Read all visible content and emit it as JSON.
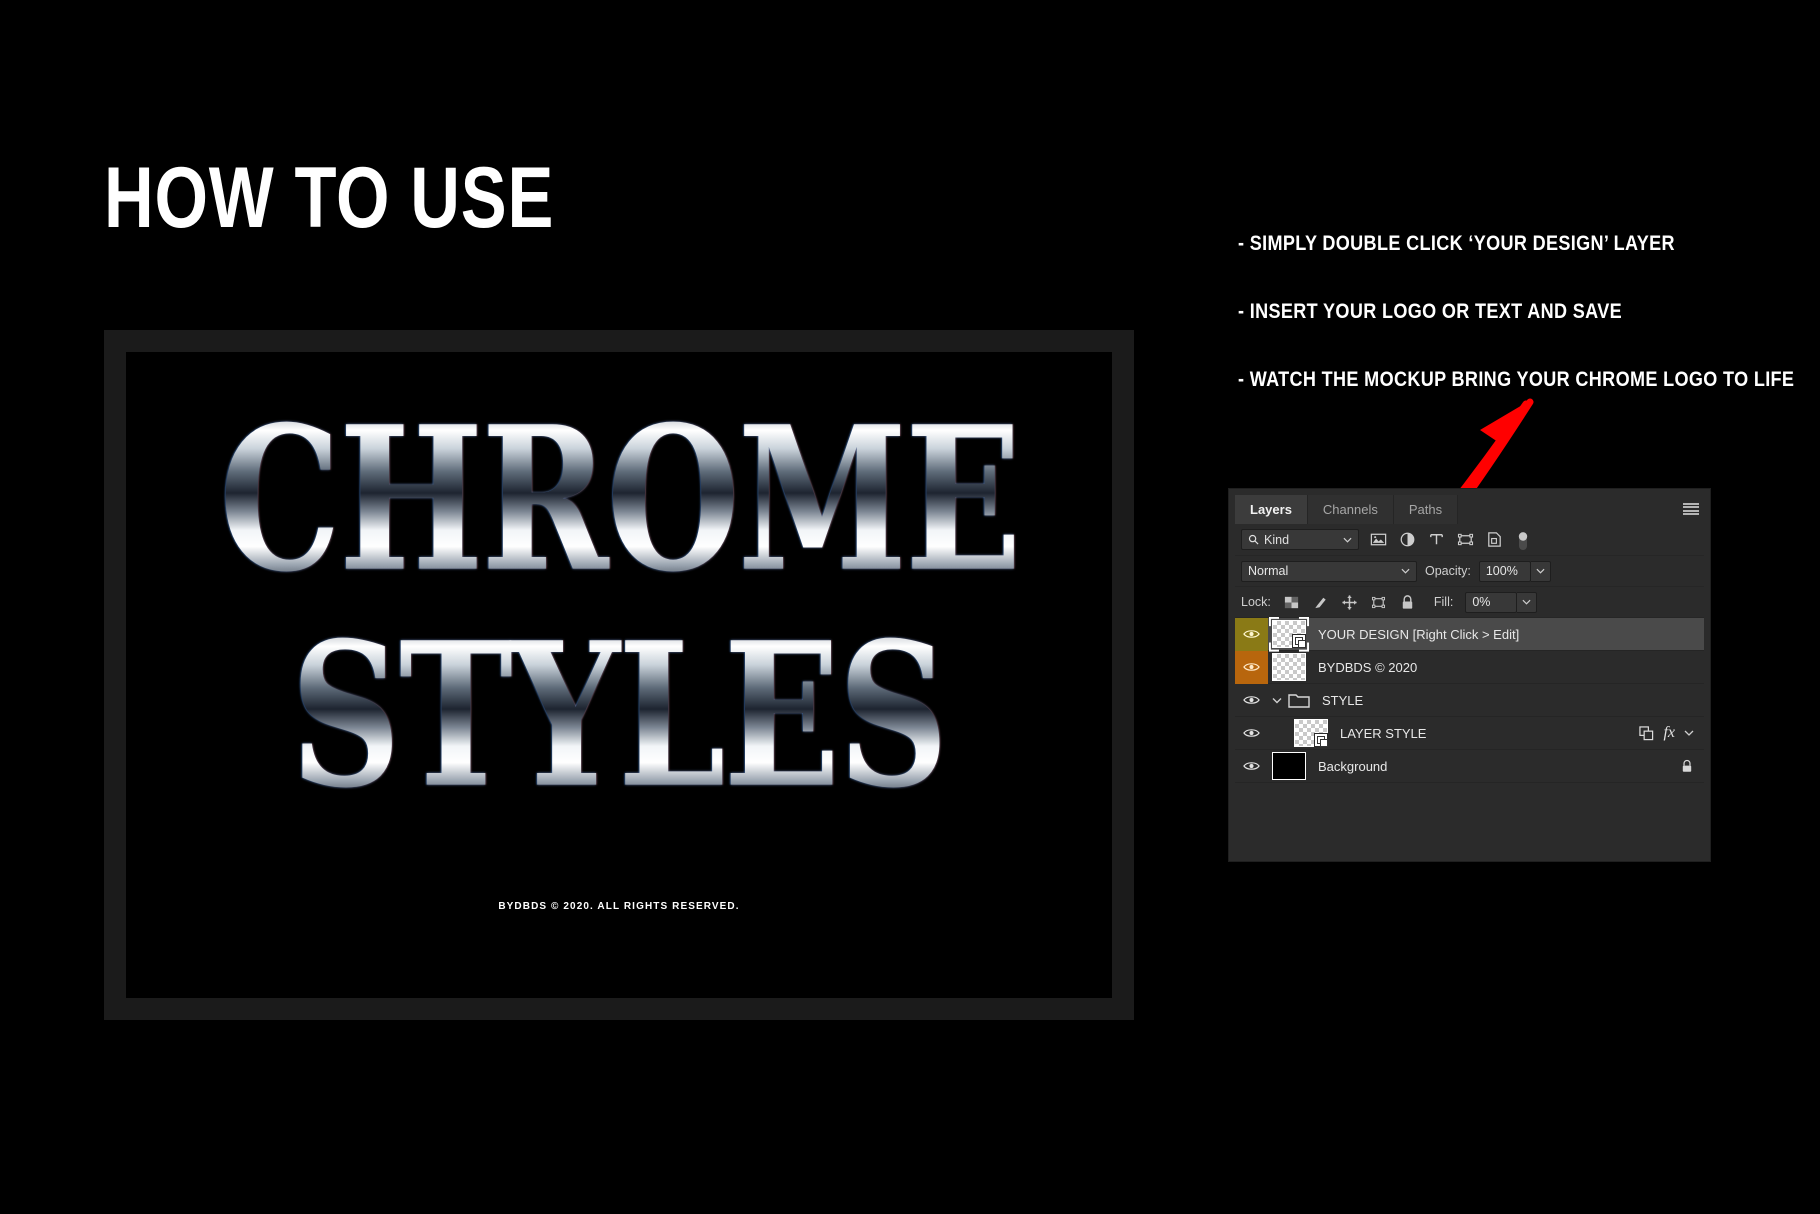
{
  "page": {
    "title": "HOW TO USE",
    "background_color": "#000000",
    "accent_color": "#ff0000"
  },
  "artwork": {
    "frame_color": "#1b1b1b",
    "canvas_color": "#000000",
    "line1": "CHROME",
    "line2": "STYLES",
    "caption": "BYDBDS © 2020. ALL RIGHTS RESERVED.",
    "style": "chrome"
  },
  "instructions": [
    {
      "text": "- SIMPLY DOUBLE CLICK ‘YOUR DESIGN’ LAYER"
    },
    {
      "text": "- INSERT YOUR LOGO OR TEXT AND SAVE"
    },
    {
      "text": "- WATCH THE MOCKUP BRING YOUR CHROME LOGO TO LIFE"
    }
  ],
  "annotation": {
    "type": "arrow",
    "color": "#ff0000",
    "description": "hand-drawn red arrow from layers panel to third instruction"
  },
  "layers_panel": {
    "tabs": [
      {
        "label": "Layers",
        "active": true
      },
      {
        "label": "Channels",
        "active": false
      },
      {
        "label": "Paths",
        "active": false
      }
    ],
    "menu_icon": "hamburger-icon",
    "filter": {
      "kind_label": "Kind",
      "search_icon": "search-icon",
      "chevron_icon": "chevron-down-icon",
      "icons": [
        "pixel-layer-filter-icon",
        "adjustment-layer-filter-icon",
        "type-layer-filter-icon",
        "shape-layer-filter-icon",
        "smart-object-filter-icon"
      ],
      "toggle": "filter-toggle-switch"
    },
    "blend": {
      "mode": "Normal",
      "opacity_label": "Opacity:",
      "opacity_value": "100%"
    },
    "lock": {
      "label": "Lock:",
      "icons": [
        "lock-transparent-pixels-icon",
        "lock-image-pixels-icon",
        "lock-position-icon",
        "lock-artboard-nesting-icon",
        "lock-all-icon"
      ],
      "fill_label": "Fill:",
      "fill_value": "0%"
    },
    "layers": [
      {
        "name": "YOUR DESIGN [Right Click > Edit]",
        "visible": true,
        "selected": true,
        "thumb": "smart-object-thumbnail",
        "eye_tint": "#8a7a16",
        "indent": 0,
        "has_fx": false,
        "locked": false
      },
      {
        "name": "BYDBDS © 2020",
        "visible": true,
        "selected": false,
        "thumb": "transparent-thumbnail",
        "eye_tint": "#b8660d",
        "indent": 0,
        "has_fx": false,
        "locked": false
      },
      {
        "name": "STYLE",
        "visible": true,
        "selected": false,
        "thumb": "folder",
        "eye_tint": "",
        "indent": 0,
        "has_fx": false,
        "locked": false
      },
      {
        "name": "LAYER STYLE",
        "visible": true,
        "selected": false,
        "thumb": "smart-object-thumbnail",
        "eye_tint": "",
        "indent": 1,
        "has_fx": true,
        "fx_label": "fx",
        "locked": false
      },
      {
        "name": "Background",
        "visible": true,
        "selected": false,
        "thumb": "solid-black-thumbnail",
        "eye_tint": "",
        "indent": 0,
        "has_fx": false,
        "locked": true
      }
    ]
  }
}
